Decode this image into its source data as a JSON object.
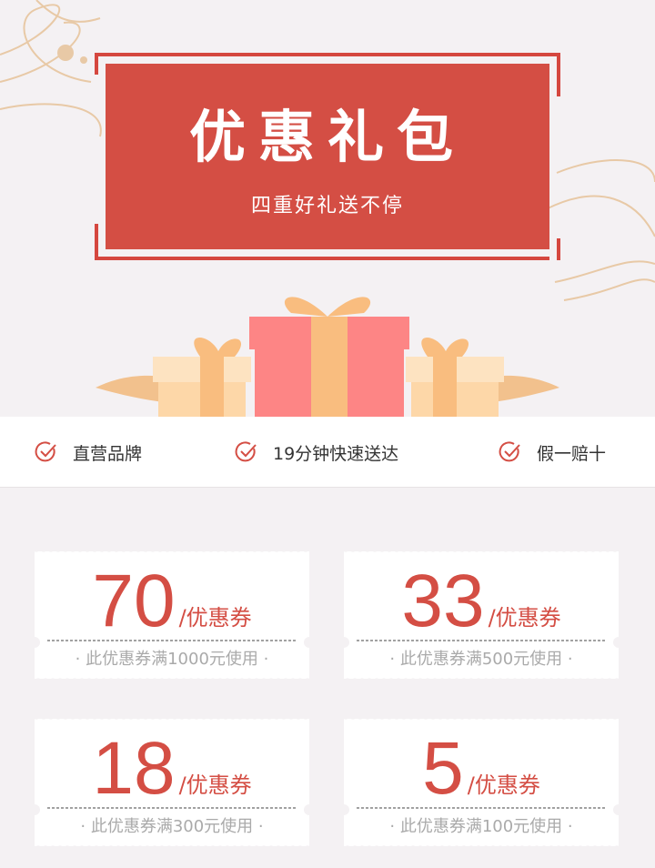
{
  "banner": {
    "title": "优惠礼包",
    "subtitle": "四重好礼送不停"
  },
  "features": [
    {
      "icon": "check-circle-icon",
      "label": "直营品牌"
    },
    {
      "icon": "check-circle-icon",
      "label": "19分钟快速送达"
    },
    {
      "icon": "check-circle-icon",
      "label": "假一赔十"
    }
  ],
  "coupons": [
    {
      "amount": "70",
      "unit": "/优惠券",
      "condition": "· 此优惠券满1000元使用 ·"
    },
    {
      "amount": "33",
      "unit": "/优惠券",
      "condition": "· 此优惠券满500元使用 ·"
    },
    {
      "amount": "18",
      "unit": "/优惠券",
      "condition": "· 此优惠券满300元使用 ·"
    },
    {
      "amount": "5",
      "unit": "/优惠券",
      "condition": "· 此优惠券满100元使用 ·"
    }
  ],
  "colors": {
    "accent": "#d44e44",
    "background": "#f4f1f3",
    "gift_pink": "#fd8585",
    "gift_peach": "#fdd7a8",
    "ribbon": "#f9bd7f"
  }
}
